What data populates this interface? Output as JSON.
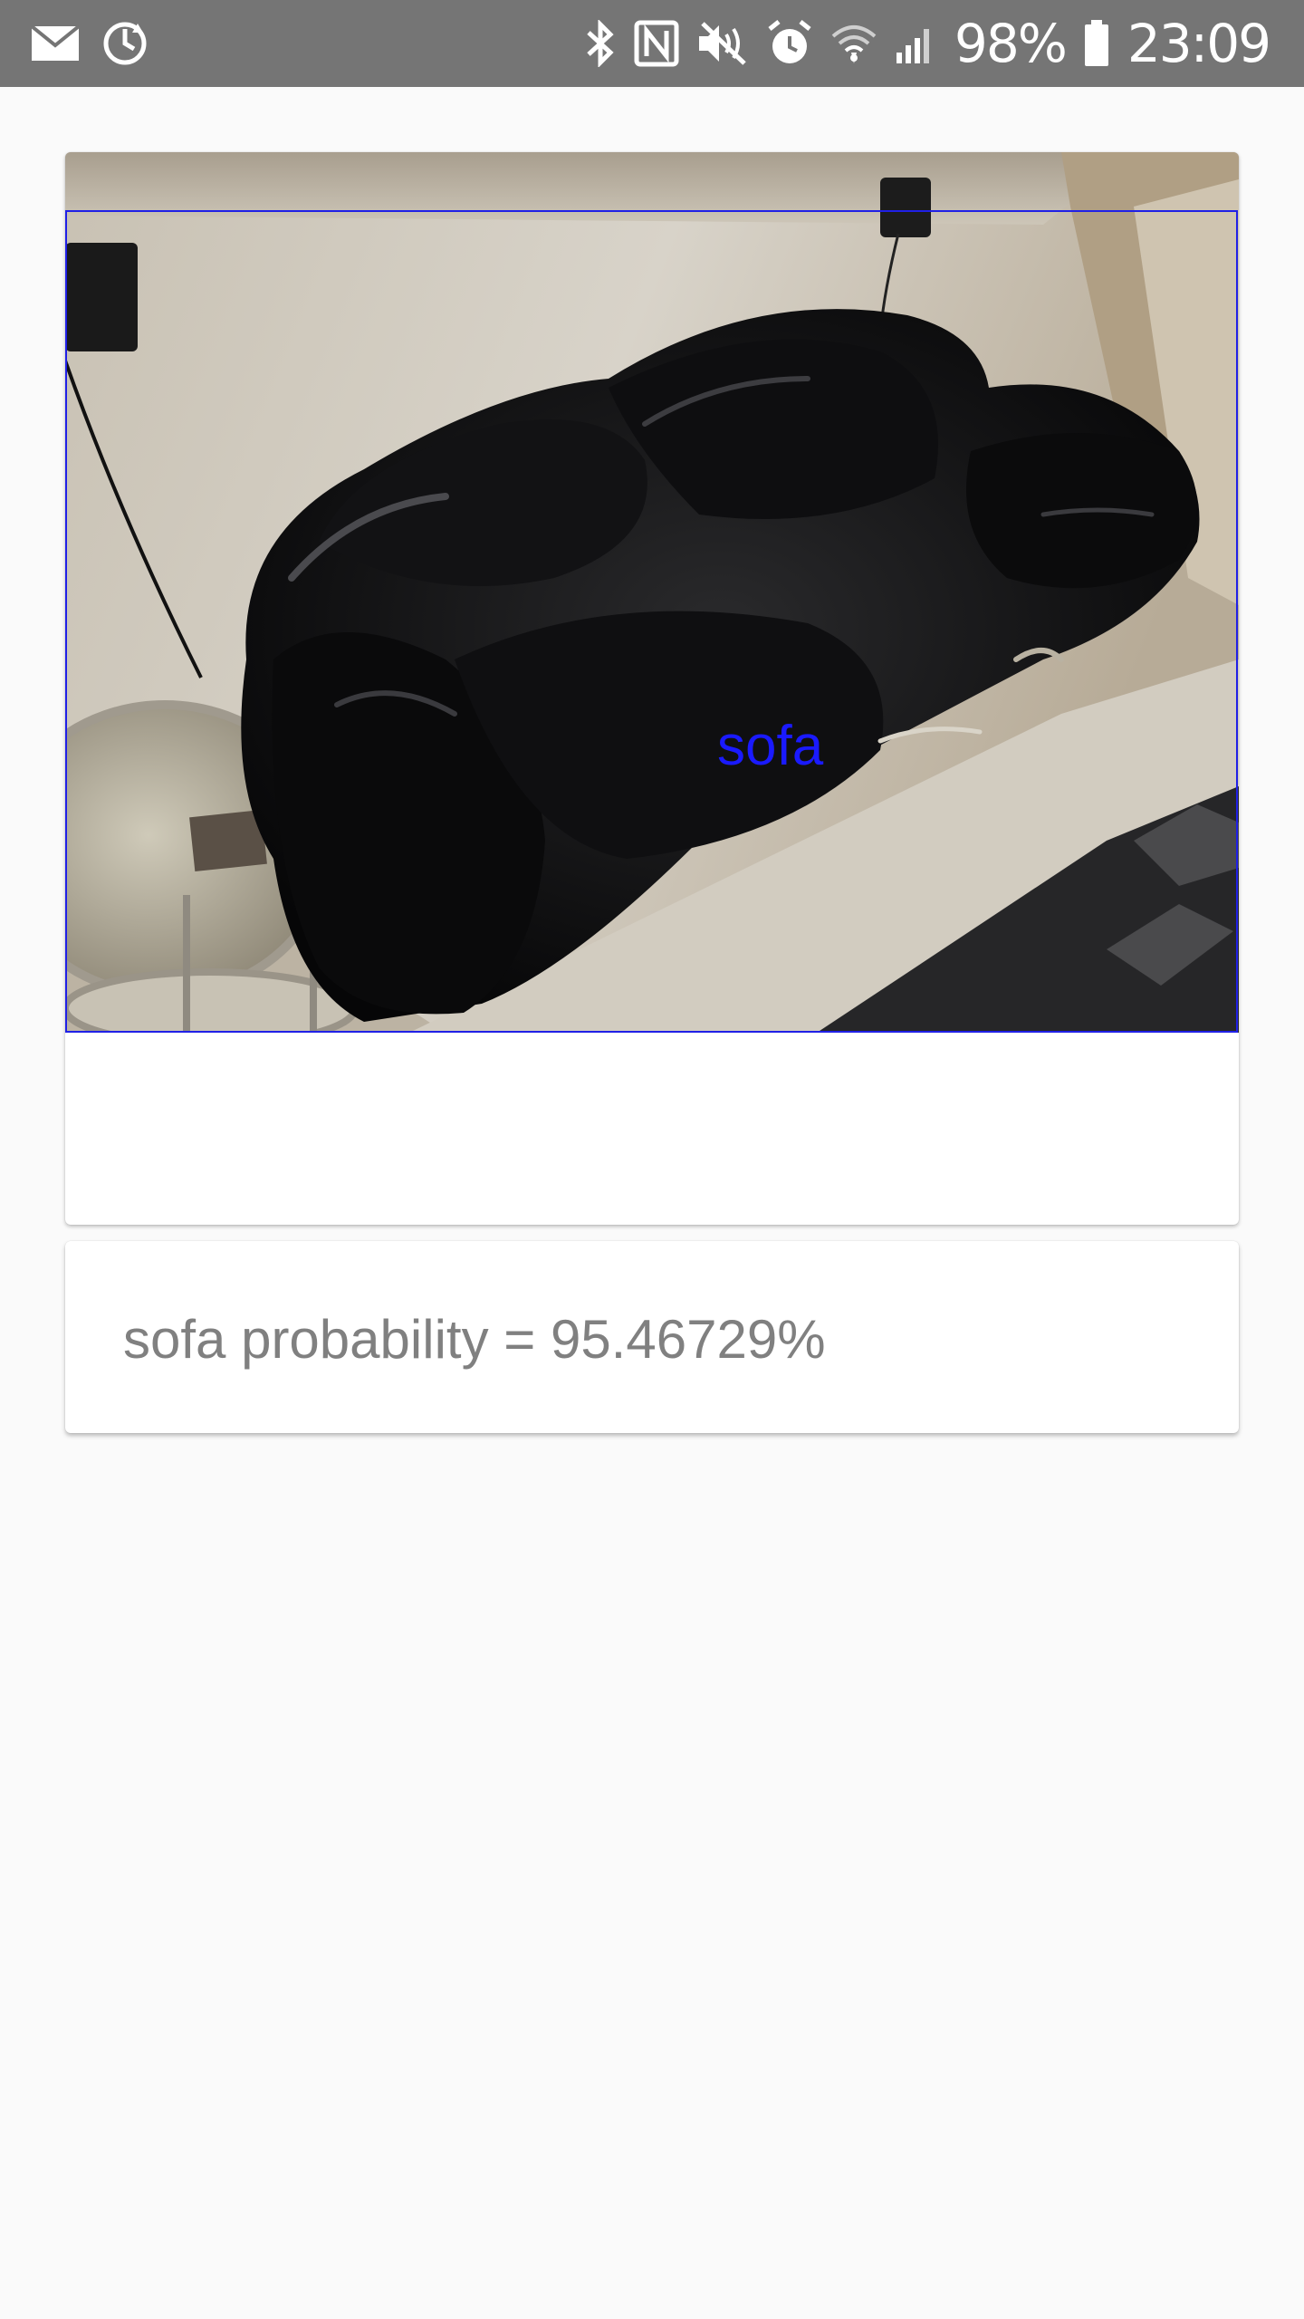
{
  "status_bar": {
    "battery": "98%",
    "time": "23:09",
    "left_icons": [
      "mail-icon",
      "sync-icon"
    ],
    "right_icons": [
      "bluetooth-icon",
      "nfc-icon",
      "mute-icon",
      "alarm-icon",
      "wifi-icon",
      "signal-icon",
      "battery-icon"
    ]
  },
  "detection": {
    "label": "sofa",
    "box_color": "#1a1aff"
  },
  "result": {
    "text": "sofa probability = 95.46729%"
  }
}
